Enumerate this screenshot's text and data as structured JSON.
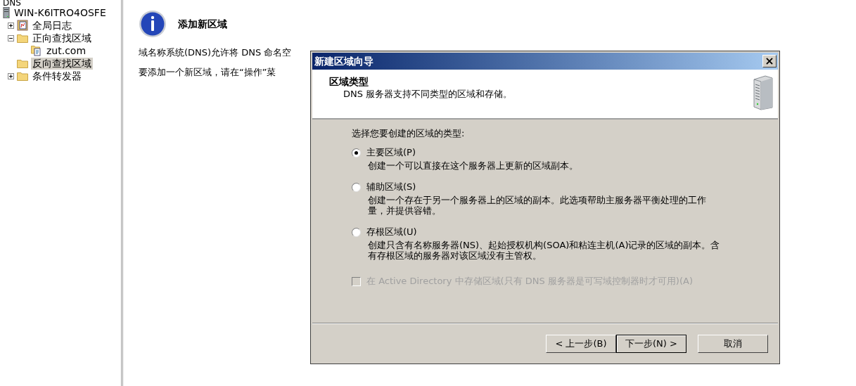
{
  "tree": {
    "root": "DNS",
    "items": [
      {
        "label": "WIN-K6ITRO4OSFE",
        "kind": "server",
        "selected": false,
        "children": [
          {
            "label": "全局日志",
            "kind": "log",
            "expanded": false,
            "selected": false
          },
          {
            "label": "正向查找区域",
            "kind": "folder",
            "expanded": true,
            "selected": false,
            "children": [
              {
                "label": "zut.com",
                "kind": "zone",
                "selected": false
              }
            ]
          },
          {
            "label": "反向查找区域",
            "kind": "folder",
            "selected": true
          },
          {
            "label": "条件转发器",
            "kind": "folder",
            "expanded": false,
            "selected": false
          }
        ]
      }
    ]
  },
  "info": {
    "title": "添加新区域",
    "paragraphs": [
      "域名称系统(DNS)允许将 DNS 命名空",
      "要添加一个新区域，请在“操作”菜"
    ]
  },
  "dialog": {
    "title": "新建区域向导",
    "close": "×",
    "header": {
      "title": "区域类型",
      "subtitle": "DNS 服务器支持不同类型的区域和存储。"
    },
    "prompt": "选择您要创建的区域的类型:",
    "options": [
      {
        "label": "主要区域(P)",
        "description": "创建一个可以直接在这个服务器上更新的区域副本。",
        "selected": true
      },
      {
        "label": "辅助区域(S)",
        "description": "创建一个存在于另一个服务器上的区域的副本。此选项帮助主服务器平衡处理的工作量，并提供容错。",
        "selected": false
      },
      {
        "label": "存根区域(U)",
        "description": "创建只含有名称服务器(NS)、起始授权机构(SOA)和粘连主机(A)记录的区域的副本。含有存根区域的服务器对该区域没有主管权。",
        "selected": false
      }
    ],
    "store_in_ad": {
      "label": "在 Active Directory 中存储区域(只有 DNS 服务器是可写域控制器时才可用)(A)",
      "checked": false,
      "disabled": true
    },
    "buttons": [
      {
        "label": "< 上一步(B)",
        "kind": "back",
        "default": false
      },
      {
        "label": "下一步(N) >",
        "kind": "next",
        "default": true
      },
      {
        "label": "取消",
        "kind": "cancel",
        "default": false
      }
    ]
  }
}
